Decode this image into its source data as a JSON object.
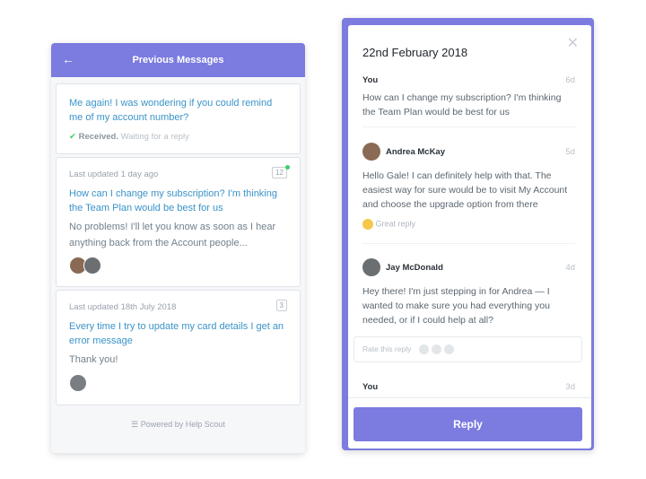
{
  "left": {
    "title": "Previous Messages",
    "footer": "Powered by Help Scout",
    "cards": [
      {
        "title": "Me again! I was wondering if you could remind me of my account number?",
        "status": "Received.",
        "status_detail": "Waiting for a reply"
      },
      {
        "meta": "Last updated 1 day ago",
        "count": "12",
        "title": "How can I change my subscription? I'm thinking the Team Plan would be best for us",
        "preview": "No problems! I'll let you know as soon as I hear anything back from the Account people..."
      },
      {
        "meta": "Last updated 18th July 2018",
        "count": "3",
        "title": "Every time I try to update my card details I get an error message",
        "preview": "Thank you!"
      }
    ]
  },
  "right": {
    "date": "22nd February 2018",
    "reply_label": "Reply",
    "rate_label": "Rate this reply",
    "messages": [
      {
        "author": "You",
        "time": "6d",
        "text": "How can I change my subscription? I'm thinking the Team Plan would be best for us"
      },
      {
        "author": "Andrea McKay",
        "time": "5d",
        "text": "Hello Gale! I can definitely help with that. The easiest way for sure would be to visit My Account and choose the upgrade option from there",
        "rating": "Great reply"
      },
      {
        "author": "Jay McDonald",
        "time": "4d",
        "text": "Hey there! I'm just stepping in for Andrea — I wanted to make sure you had everything you needed, or if I could help at all?"
      },
      {
        "author": "You",
        "time": "3d"
      }
    ]
  },
  "colors": {
    "accent": "#7b7be0",
    "link": "#3a93c8",
    "online": "#3ecf6f"
  }
}
